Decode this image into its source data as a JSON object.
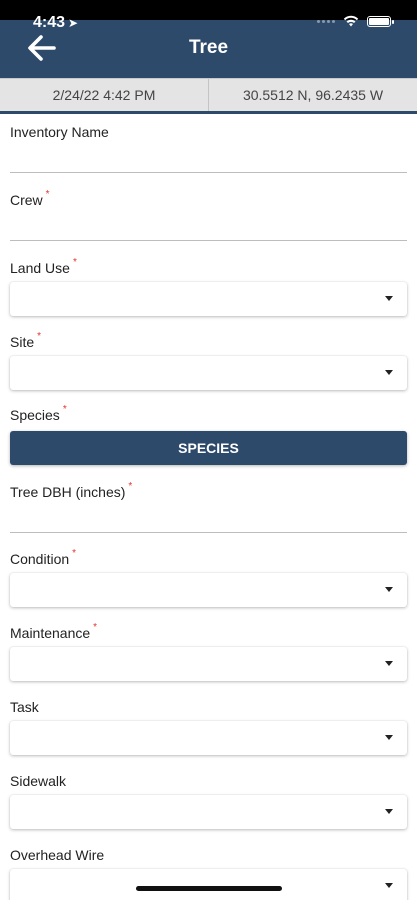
{
  "status_bar": {
    "time": "4:43"
  },
  "header": {
    "title": "Tree"
  },
  "info_bar": {
    "date": "2/24/22 4:42 PM",
    "coords": "30.5512 N, 96.2435 W"
  },
  "form": {
    "inventory_name": {
      "label": "Inventory Name"
    },
    "crew": {
      "label": "Crew"
    },
    "land_use": {
      "label": "Land Use"
    },
    "site": {
      "label": "Site"
    },
    "species": {
      "label": "Species",
      "button": "SPECIES"
    },
    "tree_dbh": {
      "label": "Tree DBH (inches)"
    },
    "condition": {
      "label": "Condition"
    },
    "maintenance": {
      "label": "Maintenance"
    },
    "task": {
      "label": "Task"
    },
    "sidewalk": {
      "label": "Sidewalk"
    },
    "overhead_wire": {
      "label": "Overhead Wire"
    }
  },
  "required_marker": "*",
  "colors": {
    "header": "#2e4a6b",
    "required": "#e5322e",
    "info_bar": "#e4e4e4"
  }
}
